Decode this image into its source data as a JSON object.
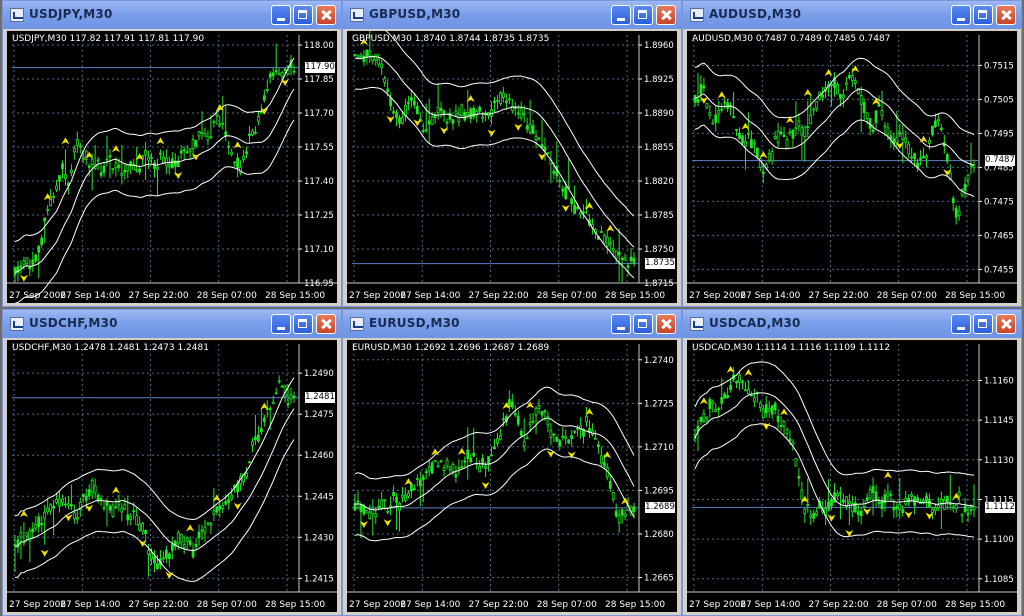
{
  "windows": [
    {
      "title": "USDJPY,M30",
      "info": "USDJPY,M30  117.82 117.91 117.81 117.90",
      "current_price": "117.90",
      "current_price_value": 117.9,
      "price_axis": [
        "118.00",
        "117.85",
        "117.70",
        "117.55",
        "117.40",
        "117.25",
        "117.10",
        "116.95"
      ],
      "price_min": 116.95,
      "price_max": 118.0,
      "time_axis": [
        "27 Sep 2006",
        "27 Sep 14:00",
        "27 Sep 22:00",
        "28 Sep 07:00",
        "28 Sep 15:00"
      ],
      "trend": [
        116.99,
        117.05,
        117.02,
        117.08,
        117.25,
        117.32,
        117.45,
        117.4,
        117.58,
        117.52,
        117.48,
        117.45,
        117.5,
        117.47,
        117.44,
        117.48,
        117.45,
        117.52,
        117.48,
        117.5,
        117.48,
        117.47,
        117.52,
        117.55,
        117.6,
        117.58,
        117.7,
        117.62,
        117.5,
        117.45,
        117.55,
        117.62,
        117.72,
        117.85,
        117.9,
        117.88,
        117.9
      ]
    },
    {
      "title": "GBPUSD,M30",
      "info": "GBPUSD,M30  1.8740 1.8744 1.8735 1.8735",
      "current_price": "1.8735",
      "current_price_value": 1.8735,
      "price_axis": [
        "1.8960",
        "1.8925",
        "1.8890",
        "1.8855",
        "1.8820",
        "1.8785",
        "1.8750",
        "1.8715"
      ],
      "price_min": 1.8715,
      "price_max": 1.896,
      "time_axis": [
        "27 Sep 2006",
        "27 Sep 14:00",
        "27 Sep 22:00",
        "28 Sep 07:00",
        "28 Sep 15:00"
      ],
      "trend": [
        1.895,
        1.8948,
        1.8952,
        1.8945,
        1.892,
        1.889,
        1.888,
        1.8905,
        1.8895,
        1.887,
        1.8885,
        1.889,
        1.8885,
        1.8888,
        1.8893,
        1.889,
        1.8892,
        1.8888,
        1.8895,
        1.8905,
        1.89,
        1.889,
        1.8885,
        1.887,
        1.8855,
        1.884,
        1.8825,
        1.8815,
        1.88,
        1.879,
        1.8785,
        1.877,
        1.876,
        1.875,
        1.8745,
        1.8738,
        1.8735
      ]
    },
    {
      "title": "AUDUSD,M30",
      "info": "AUDUSD,M30  0.7487 0.7489 0.7485 0.7487",
      "current_price": "0.7487",
      "current_price_value": 0.7487,
      "price_axis": [
        "0.7515",
        "0.7505",
        "0.7495",
        "0.7485",
        "0.7475",
        "0.7465",
        "0.7455"
      ],
      "price_min": 0.7451,
      "price_max": 0.7521,
      "time_axis": [
        "27 Sep 2006",
        "27 Sep 14:00",
        "27 Sep 22:00",
        "28 Sep 07:00",
        "28 Sep 15:00"
      ],
      "trend": [
        0.7505,
        0.751,
        0.7498,
        0.75,
        0.7505,
        0.75,
        0.7492,
        0.7495,
        0.7488,
        0.7482,
        0.749,
        0.7495,
        0.7493,
        0.7498,
        0.7495,
        0.75,
        0.7505,
        0.7508,
        0.751,
        0.7505,
        0.7512,
        0.7508,
        0.75,
        0.7498,
        0.7503,
        0.7496,
        0.7492,
        0.7495,
        0.7488,
        0.7485,
        0.749,
        0.75,
        0.7495,
        0.748,
        0.747,
        0.7482,
        0.7487
      ]
    },
    {
      "title": "USDCHF,M30",
      "info": "USDCHF,M30  1.2478 1.2481 1.2473 1.2481",
      "current_price": "1.2481",
      "current_price_value": 1.2481,
      "price_axis": [
        "1.2490",
        "1.2475",
        "1.2460",
        "1.2445",
        "1.2430",
        "1.2415"
      ],
      "price_min": 1.241,
      "price_max": 1.2497,
      "time_axis": [
        "27 Sep 2006",
        "27 Sep 14:00",
        "27 Sep 22:00",
        "28 Sep 07:00",
        "28 Sep 15:00"
      ],
      "trend": [
        1.2428,
        1.243,
        1.2432,
        1.2435,
        1.244,
        1.2442,
        1.2445,
        1.244,
        1.2438,
        1.2445,
        1.2448,
        1.2444,
        1.244,
        1.2442,
        1.244,
        1.2438,
        1.2435,
        1.2428,
        1.2422,
        1.242,
        1.2425,
        1.243,
        1.2428,
        1.2425,
        1.243,
        1.2435,
        1.244,
        1.2442,
        1.2445,
        1.245,
        1.2455,
        1.2465,
        1.2472,
        1.2478,
        1.2488,
        1.2482,
        1.2481
      ]
    },
    {
      "title": "EURUSD,M30",
      "info": "EURUSD,M30  1.2692 1.2696 1.2687 1.2689",
      "current_price": "1.2689",
      "current_price_value": 1.2689,
      "price_axis": [
        "1.2740",
        "1.2725",
        "1.2710",
        "1.2695",
        "1.2680",
        "1.2665"
      ],
      "price_min": 1.266,
      "price_max": 1.2742,
      "time_axis": [
        "27 Sep 2006",
        "27 Sep 14:00",
        "27 Sep 22:00",
        "28 Sep 07:00",
        "28 Sep 15:00"
      ],
      "trend": [
        1.269,
        1.2688,
        1.2685,
        1.269,
        1.2688,
        1.2692,
        1.269,
        1.2695,
        1.2698,
        1.27,
        1.2703,
        1.2706,
        1.2702,
        1.27,
        1.2705,
        1.2707,
        1.2705,
        1.2703,
        1.271,
        1.2715,
        1.2725,
        1.272,
        1.2712,
        1.272,
        1.2725,
        1.2718,
        1.2712,
        1.2715,
        1.2712,
        1.2716,
        1.2718,
        1.2712,
        1.2705,
        1.2695,
        1.2685,
        1.2688,
        1.2689
      ]
    },
    {
      "title": "USDCAD,M30",
      "info": "USDCAD,M30  1.1114 1.1116 1.1109 1.1112",
      "current_price": "1.1112",
      "current_price_value": 1.1112,
      "price_axis": [
        "1.1160",
        "1.1145",
        "1.1130",
        "1.1115",
        "1.1100",
        "1.1085"
      ],
      "price_min": 1.108,
      "price_max": 1.117,
      "time_axis": [
        "27 Sep 2006",
        "27 Sep 14:00",
        "27 Sep 22:00",
        "28 Sep 07:00",
        "28 Sep 15:00"
      ],
      "trend": [
        1.114,
        1.1145,
        1.115,
        1.1148,
        1.1155,
        1.116,
        1.1162,
        1.1155,
        1.1152,
        1.1148,
        1.115,
        1.1145,
        1.114,
        1.113,
        1.1112,
        1.1108,
        1.1112,
        1.111,
        1.1115,
        1.1118,
        1.1112,
        1.111,
        1.1114,
        1.1118,
        1.1112,
        1.1115,
        1.111,
        1.1112,
        1.1115,
        1.1113,
        1.1116,
        1.111,
        1.1114,
        1.1112,
        1.1115,
        1.111,
        1.1112
      ]
    }
  ]
}
